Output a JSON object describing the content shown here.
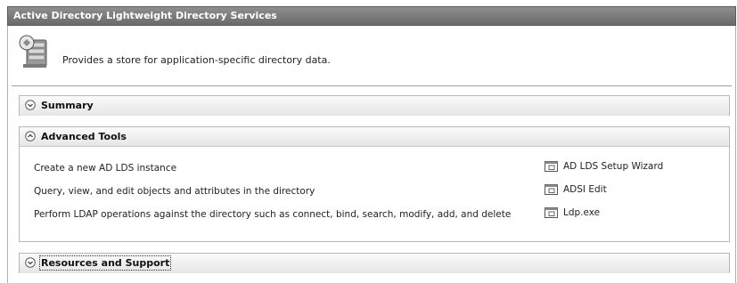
{
  "window": {
    "title": "Active Directory Lightweight Directory Services"
  },
  "header": {
    "icon": "server-icon",
    "description": "Provides a store for application-specific directory data."
  },
  "sections": [
    {
      "label": "Summary",
      "state": "collapsed",
      "icon": "chevron-down-icon"
    },
    {
      "label": "Advanced Tools",
      "state": "expanded",
      "icon": "chevron-up-icon",
      "tools": [
        {
          "description": "Create a new AD LDS instance",
          "link": "AD LDS Setup Wizard",
          "icon": "window-icon"
        },
        {
          "description": "Query, view, and edit objects and attributes in the directory",
          "link": "ADSI Edit",
          "icon": "window-icon"
        },
        {
          "description": "Perform LDAP operations against the directory such as connect, bind, search, modify, add, and delete",
          "link": "Ldp.exe",
          "icon": "window-icon"
        }
      ]
    },
    {
      "label": "Resources and Support",
      "state": "collapsed",
      "icon": "chevron-down-icon"
    }
  ]
}
